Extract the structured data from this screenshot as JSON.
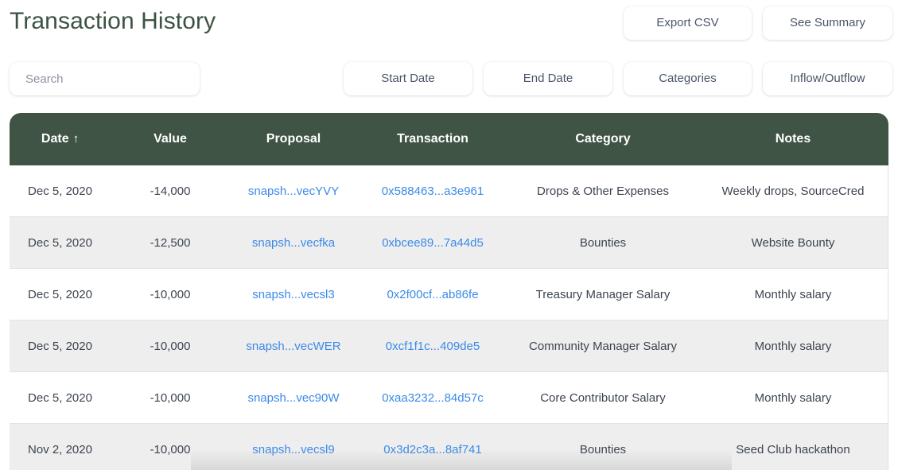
{
  "header": {
    "title": "Transaction History",
    "export_label": "Export CSV",
    "summary_label": "See Summary"
  },
  "filters": {
    "search_placeholder": "Search",
    "search_value": "",
    "start_date_label": "Start Date",
    "end_date_label": "End Date",
    "categories_label": "Categories",
    "inflow_outflow_label": "Inflow/Outflow"
  },
  "table": {
    "columns": [
      {
        "label": "Date",
        "sort": "↑"
      },
      {
        "label": "Value",
        "sort": ""
      },
      {
        "label": "Proposal",
        "sort": ""
      },
      {
        "label": "Transaction",
        "sort": ""
      },
      {
        "label": "Category",
        "sort": ""
      },
      {
        "label": "Notes",
        "sort": ""
      }
    ],
    "rows": [
      {
        "date": "Dec 5, 2020",
        "value": "-14,000",
        "proposal": "snapsh...vecYVY",
        "transaction": "0x588463...a3e961",
        "category": "Drops & Other Expenses",
        "notes": "Weekly drops, SourceCred"
      },
      {
        "date": "Dec 5, 2020",
        "value": "-12,500",
        "proposal": "snapsh...vecfka",
        "transaction": "0xbcee89...7a44d5",
        "category": "Bounties",
        "notes": "Website Bounty"
      },
      {
        "date": "Dec 5, 2020",
        "value": "-10,000",
        "proposal": "snapsh...vecsl3",
        "transaction": "0x2f00cf...ab86fe",
        "category": "Treasury Manager Salary",
        "notes": "Monthly salary"
      },
      {
        "date": "Dec 5, 2020",
        "value": "-10,000",
        "proposal": "snapsh...vecWER",
        "transaction": "0xcf1f1c...409de5",
        "category": "Community Manager Salary",
        "notes": "Monthly salary"
      },
      {
        "date": "Dec 5, 2020",
        "value": "-10,000",
        "proposal": "snapsh...vec90W",
        "transaction": "0xaa3232...84d57c",
        "category": "Core Contributor Salary",
        "notes": "Monthly salary"
      },
      {
        "date": "Nov 2, 2020",
        "value": "-10,000",
        "proposal": "snapsh...vecsl9",
        "transaction": "0x3d2c3a...8af741",
        "category": "Bounties",
        "notes": "Seed Club hackathon"
      }
    ]
  },
  "colors": {
    "title": "#3c5242",
    "table_header_bg": "#3f5445",
    "link": "#3b8ae8",
    "row_alt_bg": "#eeeeee",
    "body_text": "#3d4450"
  }
}
